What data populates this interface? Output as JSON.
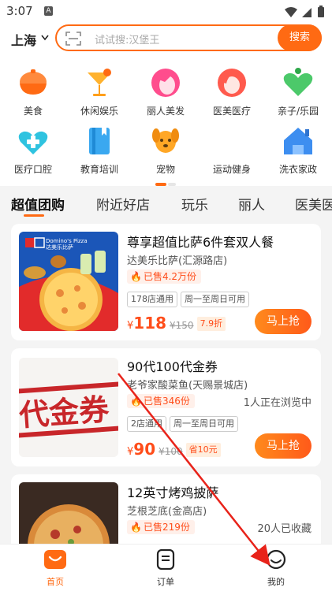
{
  "status_bar": {
    "time": "3:07",
    "badge": "A"
  },
  "header": {
    "city": "上海",
    "search_placeholder": "试试搜:汉堡王",
    "search_button": "搜索"
  },
  "categories": [
    {
      "label": "美食",
      "icon": "food-bowl-icon",
      "color": "#ff6a13"
    },
    {
      "label": "休闲娱乐",
      "icon": "cocktail-icon",
      "color": "#ff9f1a"
    },
    {
      "label": "丽人美发",
      "icon": "woman-face-icon",
      "color": "#ff4d8d"
    },
    {
      "label": "医美医疗",
      "icon": "beauty-face-icon",
      "color": "#ff5a4d"
    },
    {
      "label": "亲子/乐园",
      "icon": "heart-family-icon",
      "color": "#4cc96a"
    },
    {
      "label": "医疗口腔",
      "icon": "medical-cross-icon",
      "color": "#2fc3e0"
    },
    {
      "label": "教育培训",
      "icon": "book-icon",
      "color": "#3aa8f0"
    },
    {
      "label": "宠物",
      "icon": "dog-icon",
      "color": "#ffa726"
    },
    {
      "label": "运动健身",
      "icon": "dumbbell-icon",
      "color": "#ff6a5a"
    },
    {
      "label": "洗衣家政",
      "icon": "house-icon",
      "color": "#3d8ef0"
    }
  ],
  "tabs": [
    "超值团购",
    "附近好店",
    "玩乐",
    "丽人",
    "医美医"
  ],
  "deals": [
    {
      "title": "尊享超值比萨6件套双人餐",
      "shop": "达美乐比萨(汇源路店)",
      "sold": "已售4.2万份",
      "extra": "",
      "tags": [
        "178店通用",
        "周一至周日可用"
      ],
      "price": "118",
      "original": "¥150",
      "discount": "7.9折",
      "button": "马上抢",
      "image_brand": "Domino's Pizza",
      "image_brand_cn": "达美乐比萨"
    },
    {
      "title": "90代100代金券",
      "shop": "老爷家酸菜鱼(天赐景城店)",
      "sold": "已售346份",
      "extra": "1人正在浏览中",
      "tags": [
        "2店通用",
        "周一至周日可用"
      ],
      "price": "90",
      "original": "¥100",
      "discount": "省10元",
      "button": "马上抢",
      "image_text": "代金券"
    },
    {
      "title": "12英寸烤鸡披萨",
      "shop": "芝根芝底(金高店)",
      "sold": "已售219份",
      "extra": "20人已收藏",
      "tags": [],
      "price": "",
      "original": "",
      "discount": "",
      "button": ""
    }
  ],
  "bottom_nav": [
    {
      "label": "首页",
      "icon": "home-icon",
      "active": true
    },
    {
      "label": "订单",
      "icon": "order-list-icon",
      "active": false
    },
    {
      "label": "我的",
      "icon": "profile-icon",
      "active": false
    }
  ],
  "colors": {
    "accent": "#ff6a13",
    "price": "#ff4d1a",
    "annotation_arrow": "#e8231a"
  }
}
